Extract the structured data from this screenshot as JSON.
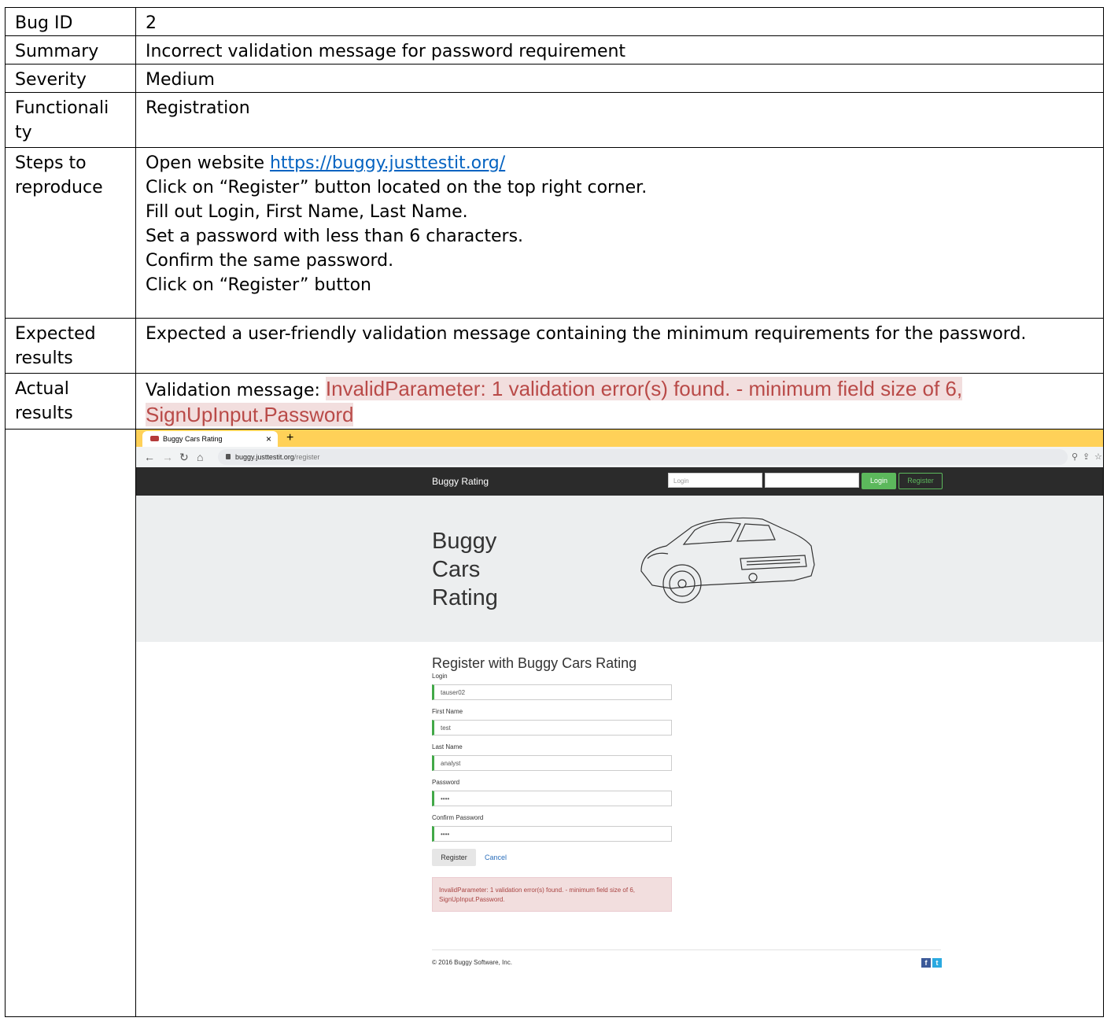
{
  "rows": {
    "bug_id": {
      "label": "Bug ID",
      "value": "2"
    },
    "summary": {
      "label": "Summary",
      "value": "Incorrect validation message for password requirement"
    },
    "severity": {
      "label": "Severity",
      "value": "Medium"
    },
    "functionality": {
      "label_line1": "Functionali",
      "label_line2": "ty",
      "value": "Registration"
    },
    "steps": {
      "label_line1": "Steps to",
      "label_line2": "reproduce",
      "step1_prefix": "Open website ",
      "step1_link": "https://buggy.justtestit.org/",
      "step2": "Click on “Register” button located on the top right corner.",
      "step3": "Fill out Login, First Name, Last Name.",
      "step4": "Set a password with less than 6 characters.",
      "step5": "Confirm the same password.",
      "step6": "Click on “Register” button"
    },
    "expected": {
      "label_line1": "Expected",
      "label_line2": "results",
      "value": "Expected a user-friendly validation message containing the minimum requirements for the password."
    },
    "actual": {
      "label_line1": "Actual",
      "label_line2": "results",
      "prefix": "Validation message: ",
      "msg_line1": "InvalidParameter: 1 validation error(s) found. - minimum field size of 6,",
      "msg_line2": "SignUpInput.Password"
    }
  },
  "screenshot": {
    "tab_title": "Buggy Cars Rating",
    "tab_close": "×",
    "new_tab": "+",
    "url_host": "buggy.justtestit.org",
    "url_path": "/register",
    "nav_brand": "Buggy Rating",
    "nav_login_placeholder": "Login",
    "nav_login_button": "Login",
    "nav_register_button": "Register",
    "hero_title": "Buggy Cars Rating",
    "form_title": "Register with Buggy Cars Rating",
    "fields": [
      {
        "label": "Login",
        "value": "tauser02"
      },
      {
        "label": "First Name",
        "value": "test"
      },
      {
        "label": "Last Name",
        "value": "analyst"
      },
      {
        "label": "Password",
        "value": "••••"
      },
      {
        "label": "Confirm Password",
        "value": "••••"
      }
    ],
    "register_button": "Register",
    "cancel_link": "Cancel",
    "error_message": "InvalidParameter: 1 validation error(s) found. - minimum field size of 6, SignUpInput.Password.",
    "footer": "© 2016 Buggy Software, Inc.",
    "colors": {
      "tab_bar": "#ffd158",
      "nav_bg": "#2b2b2b",
      "green": "#5cb85c",
      "alert_bg": "#f2dede",
      "alert_text": "#a94442"
    }
  }
}
